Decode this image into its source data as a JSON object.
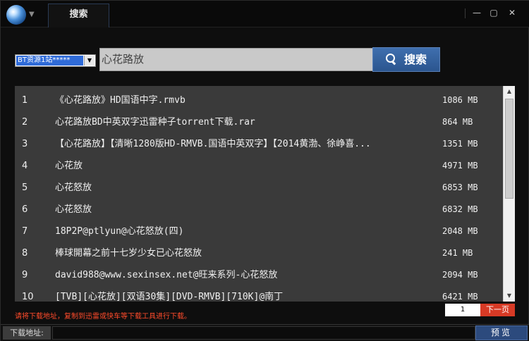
{
  "titlebar": {
    "tab_label": "搜索",
    "minimize_glyph": "—",
    "maximize_glyph": "▢",
    "close_glyph": "✕",
    "menu_caret": "▼"
  },
  "search": {
    "source_selected": "BT资源1站*****",
    "source_caret": "▼",
    "query": "心花路放",
    "button_label": "搜索"
  },
  "results": [
    {
      "no": "1",
      "name": "《心花路放》HD国语中字.rmvb",
      "size": "1086 MB"
    },
    {
      "no": "2",
      "name": "心花路放BD中英双字迅雷种子torrent下载.rar",
      "size": "864 MB"
    },
    {
      "no": "3",
      "name": "【心花路放】【清晰1280版HD-RMVB.国语中英双字】【2014黄渤、徐峥喜...",
      "size": "1351 MB"
    },
    {
      "no": "4",
      "name": "心花放",
      "size": "4971 MB"
    },
    {
      "no": "5",
      "name": "心花怒放",
      "size": "6853 MB"
    },
    {
      "no": "6",
      "name": "心花怒放",
      "size": "6832 MB"
    },
    {
      "no": "7",
      "name": "18P2P@ptlyun@心花怒放(四)",
      "size": "2048 MB"
    },
    {
      "no": "8",
      "name": "棒球開幕之前十七岁少女已心花怒放",
      "size": "241 MB"
    },
    {
      "no": "9",
      "name": "david988@www.sexinsex.net@旺来系列-心花怒放",
      "size": "2094 MB"
    },
    {
      "no": "10",
      "name": "[TVB][心花放][双语30集][DVD-RMVB][710K]@南丁",
      "size": "6421 MB"
    }
  ],
  "scrollbar": {
    "up_glyph": "▲",
    "down_glyph": "▼"
  },
  "footer": {
    "hint": "请将下载地址，复制到迅雷或快车等下载工具进行下载。",
    "page": "1",
    "next_label": "下一页",
    "download_label": "下载地址:",
    "download_value": "",
    "preview_label": "预览"
  },
  "colors": {
    "accent_blue": "#2b558f",
    "hint_red": "#ff4b2b",
    "next_red": "#d73a25",
    "list_bg": "#3a3a3a"
  }
}
